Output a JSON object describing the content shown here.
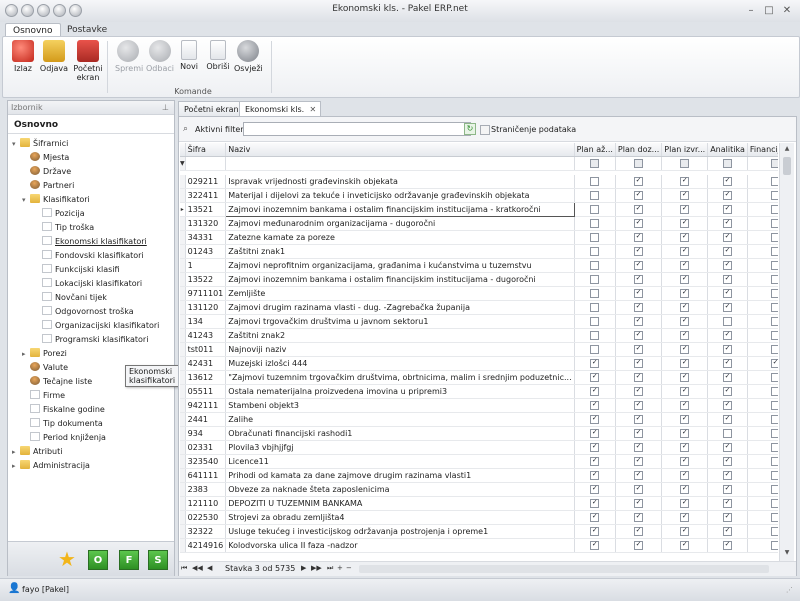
{
  "window": {
    "title": "Ekonomski kls. - Pakel ERP.net"
  },
  "ribbon": {
    "tabs": [
      "Osnovno",
      "Postavke"
    ],
    "buttons": [
      {
        "label": "Izlaz",
        "icon": "exit-icon"
      },
      {
        "label": "Odjava",
        "icon": "lock-icon"
      },
      {
        "label": "Početni ekran",
        "icon": "home-icon"
      },
      {
        "label": "Spremi",
        "icon": "check-icon"
      },
      {
        "label": "Odbaci",
        "icon": "discard-icon"
      },
      {
        "label": "Novi",
        "icon": "new-doc-icon"
      },
      {
        "label": "Obriši",
        "icon": "delete-doc-icon"
      },
      {
        "label": "Osvježi",
        "icon": "refresh-icon"
      }
    ],
    "group_label": "Komande"
  },
  "sidebar": {
    "header": "Izbornik",
    "title": "Osnovno",
    "items": [
      {
        "label": "Šifrarnici",
        "level": 0,
        "exp": "▾",
        "icon": "folder"
      },
      {
        "label": "Mjesta",
        "level": 1,
        "exp": "",
        "icon": "people"
      },
      {
        "label": "Države",
        "level": 1,
        "exp": "",
        "icon": "people"
      },
      {
        "label": "Partneri",
        "level": 1,
        "exp": "",
        "icon": "people"
      },
      {
        "label": "Klasifikatori",
        "level": 1,
        "exp": "▾",
        "icon": "folder"
      },
      {
        "label": "Pozicija",
        "level": 2,
        "exp": "",
        "icon": "doc"
      },
      {
        "label": "Tip troška",
        "level": 2,
        "exp": "",
        "icon": "doc"
      },
      {
        "label": "Ekonomski klasifikatori",
        "level": 2,
        "exp": "",
        "icon": "doc"
      },
      {
        "label": "Fondovski klasifikatori",
        "level": 2,
        "exp": "",
        "icon": "doc"
      },
      {
        "label": "Funkcijski klasifi",
        "level": 2,
        "exp": "",
        "icon": "doc"
      },
      {
        "label": "Lokacijski klasifikatori",
        "level": 2,
        "exp": "",
        "icon": "doc"
      },
      {
        "label": "Novčani tijek",
        "level": 2,
        "exp": "",
        "icon": "doc"
      },
      {
        "label": "Odgovornost troška",
        "level": 2,
        "exp": "",
        "icon": "doc"
      },
      {
        "label": "Organizacijski klasifikatori",
        "level": 2,
        "exp": "",
        "icon": "doc"
      },
      {
        "label": "Programski klasifikatori",
        "level": 2,
        "exp": "",
        "icon": "doc"
      },
      {
        "label": "Porezi",
        "level": 1,
        "exp": "▸",
        "icon": "folder"
      },
      {
        "label": "Valute",
        "level": 1,
        "exp": "",
        "icon": "people"
      },
      {
        "label": "Tečajne liste",
        "level": 1,
        "exp": "",
        "icon": "people"
      },
      {
        "label": "Firme",
        "level": 1,
        "exp": "",
        "icon": "doc"
      },
      {
        "label": "Fiskalne godine",
        "level": 1,
        "exp": "",
        "icon": "doc"
      },
      {
        "label": "Tip dokumenta",
        "level": 1,
        "exp": "",
        "icon": "doc"
      },
      {
        "label": "Period knjiženja",
        "level": 1,
        "exp": "",
        "icon": "doc"
      },
      {
        "label": "Atributi",
        "level": 0,
        "exp": "▸",
        "icon": "folder"
      },
      {
        "label": "Administracija",
        "level": 0,
        "exp": "▸",
        "icon": "folder"
      }
    ],
    "tooltip": "Ekonomski klasifikatori",
    "bottom_buttons": [
      "O",
      "F",
      "S"
    ]
  },
  "doc_tabs": [
    "Početni ekran",
    "Ekonomski kls."
  ],
  "filter": {
    "label": "Aktivni filter",
    "value": "",
    "paging_label": "Straničenje podataka"
  },
  "grid": {
    "columns": [
      "Šifra",
      "Naziv",
      "Plan až...",
      "Plan doz...",
      "Plan izvr...",
      "Analitika",
      "Financijska..."
    ],
    "rows": [
      {
        "sifra": "029211",
        "naziv": "Ispravak vrijednosti građevinskih objekata",
        "c": [
          0,
          1,
          1,
          1,
          0
        ]
      },
      {
        "sifra": "322411",
        "naziv": "Materijal i dijelovi za tekuće i inveticijsko održavanje građevinskih objekata",
        "c": [
          0,
          1,
          1,
          1,
          0
        ]
      },
      {
        "sifra": "13521",
        "naziv": "Zajmovi inozemnim bankama i ostalim financijskim institucijama - kratkoročni",
        "c": [
          0,
          1,
          1,
          1,
          0
        ]
      },
      {
        "sifra": "131320",
        "naziv": "Zajmovi međunarodnim organizacijama - dugoročni",
        "c": [
          0,
          1,
          1,
          1,
          0
        ]
      },
      {
        "sifra": "34331",
        "naziv": "Zatezne kamate za poreze",
        "c": [
          0,
          1,
          1,
          1,
          0
        ]
      },
      {
        "sifra": "01243",
        "naziv": "Zaštitni znak1",
        "c": [
          0,
          1,
          1,
          1,
          0
        ]
      },
      {
        "sifra": "1",
        "naziv": "Zajmovi neprofitnim organizacijama, građanima i kućanstvima u tuzemstvu",
        "c": [
          0,
          1,
          1,
          1,
          0
        ]
      },
      {
        "sifra": "13522",
        "naziv": "Zajmovi inozemnim bankama i ostalim financijskim institucijama - dugoročni",
        "c": [
          0,
          1,
          1,
          1,
          0
        ]
      },
      {
        "sifra": "9711101",
        "naziv": "Zemljište",
        "c": [
          0,
          1,
          1,
          1,
          0
        ]
      },
      {
        "sifra": "131120",
        "naziv": "Zajmovi drugim razinama vlasti - dug. -Zagrebačka županija",
        "c": [
          0,
          1,
          1,
          1,
          0
        ]
      },
      {
        "sifra": "134",
        "naziv": "Zajmovi trgovačkim društvima u javnom sektoru1",
        "c": [
          0,
          1,
          1,
          0,
          0
        ]
      },
      {
        "sifra": "41243",
        "naziv": "Zaštitni znak2",
        "c": [
          0,
          1,
          1,
          1,
          0
        ]
      },
      {
        "sifra": "tst011",
        "naziv": "Najnoviji naziv",
        "c": [
          0,
          1,
          1,
          1,
          0
        ]
      },
      {
        "sifra": "42431",
        "naziv": "Muzejski izlošci 444",
        "c": [
          1,
          1,
          1,
          1,
          1
        ]
      },
      {
        "sifra": "13612",
        "naziv": "\"Zajmovi tuzemnim trgovačkim društvima, obrtnicima, malim i srednjim poduzetnic...",
        "c": [
          1,
          1,
          1,
          1,
          0
        ]
      },
      {
        "sifra": "05511",
        "naziv": "Ostala nematerijalna proizvedena imovina u pripremi3",
        "c": [
          1,
          1,
          1,
          1,
          0
        ]
      },
      {
        "sifra": "942111",
        "naziv": "Stambeni objekt3",
        "c": [
          1,
          1,
          1,
          1,
          0
        ]
      },
      {
        "sifra": "2441",
        "naziv": "Zalihe",
        "c": [
          1,
          1,
          1,
          1,
          0
        ]
      },
      {
        "sifra": "934",
        "naziv": "Obračunati financijski rashodi1",
        "c": [
          1,
          1,
          1,
          0,
          0
        ]
      },
      {
        "sifra": "02331",
        "naziv": "Plovila3 vbjhjjfgj",
        "c": [
          1,
          1,
          1,
          1,
          0
        ]
      },
      {
        "sifra": "323540",
        "naziv": "Licence11",
        "c": [
          1,
          1,
          1,
          1,
          0
        ]
      },
      {
        "sifra": "641111",
        "naziv": "Prihodi od kamata za dane zajmove drugim razinama vlasti1",
        "c": [
          1,
          1,
          1,
          1,
          0
        ]
      },
      {
        "sifra": "2383",
        "naziv": "Obveze za naknade šteta zaposlenicima",
        "c": [
          1,
          1,
          1,
          1,
          0
        ]
      },
      {
        "sifra": "121110",
        "naziv": "DEPOZITI U TUZEMNIM BANKAMA",
        "c": [
          1,
          1,
          1,
          1,
          0
        ]
      },
      {
        "sifra": "022530",
        "naziv": "Strojevi za obradu zemljišta4",
        "c": [
          1,
          1,
          1,
          1,
          0
        ]
      },
      {
        "sifra": "32322",
        "naziv": "Usluge tekućeg i investicijskog održavanja postrojenja i opreme1",
        "c": [
          1,
          1,
          1,
          1,
          0
        ]
      },
      {
        "sifra": "4214916",
        "naziv": "Kolodvorska ulica II faza -nadzor",
        "c": [
          1,
          1,
          1,
          1,
          0
        ]
      }
    ],
    "selected_index": 2,
    "pager": "Stavka 3 od 5735"
  },
  "status": {
    "user": "fayo [Pakel]"
  }
}
